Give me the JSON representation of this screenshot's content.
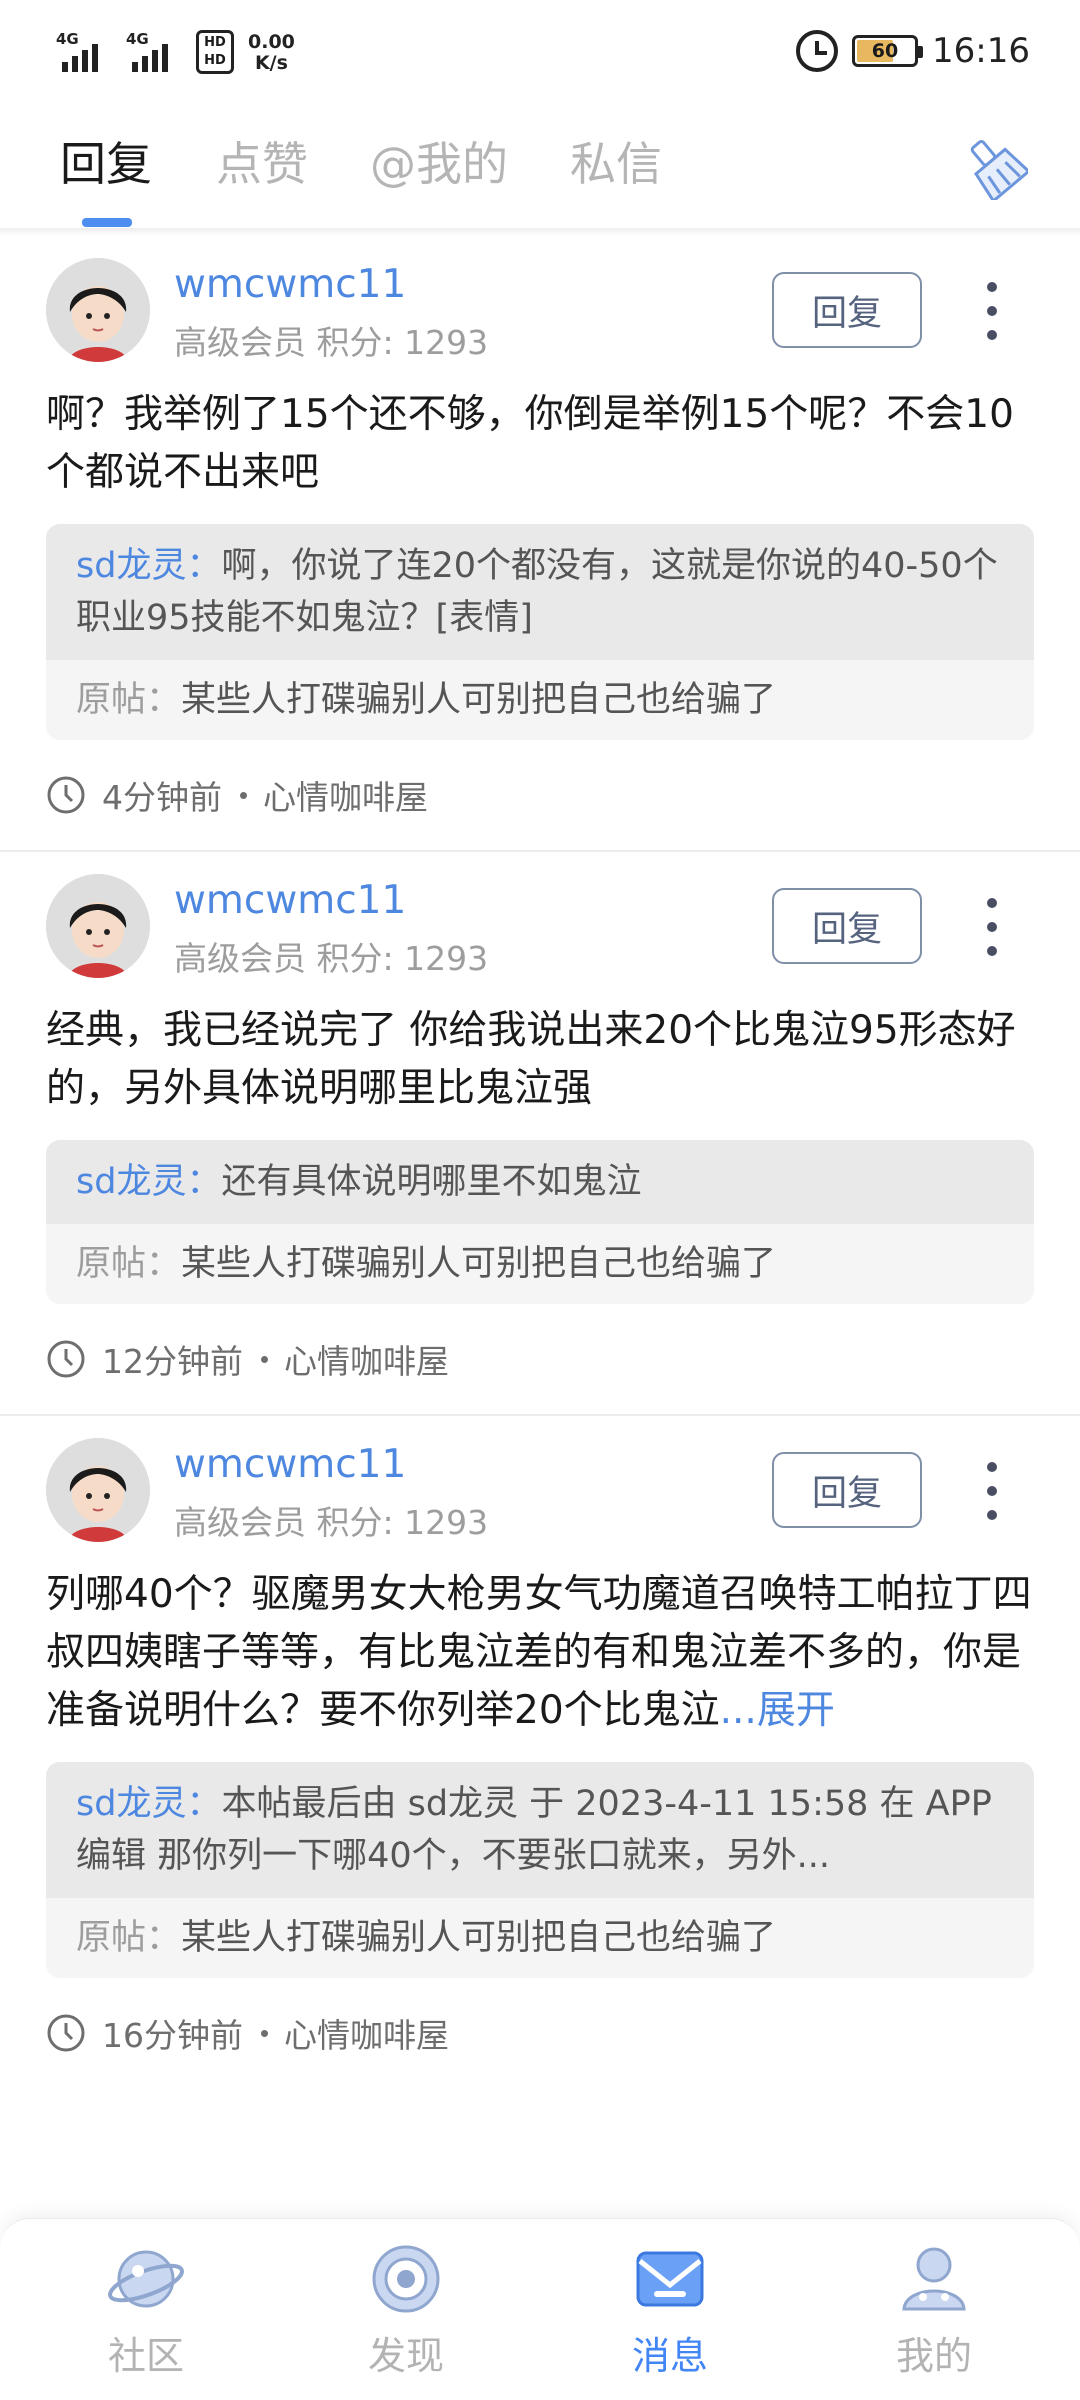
{
  "status_bar": {
    "sim1_label": "4G",
    "sim2_label": "4G",
    "hd_label_top": "HD",
    "hd_label_bottom": "HD",
    "speed_value": "0.00",
    "speed_unit": "K/s",
    "battery_level": "60",
    "time": "16:16",
    "icons": [
      "signal-icon",
      "signal-icon",
      "hd-icon",
      "alarm-icon",
      "battery-icon"
    ]
  },
  "tabs": [
    {
      "label": "回复",
      "active": true
    },
    {
      "label": "点赞",
      "active": false
    },
    {
      "label": "@我的",
      "active": false
    },
    {
      "label": "私信",
      "active": false
    }
  ],
  "header": {
    "clear_icon": "broom-icon"
  },
  "accent_color": "#4d8ef0",
  "messages": [
    {
      "username": "wmcwmc11",
      "level": "高级会员",
      "points_label": "积分: 1293",
      "reply_label": "回复",
      "content": "啊？我举例了15个还不够，你倒是举例15个呢？不会10个都说不出来吧",
      "quote_user": "sd龙灵：",
      "quote_text": "啊，你说了连20个都没有，这就是你说的40-50个职业95技能不如鬼泣？[表情]",
      "origin_label": "原帖：",
      "origin_text": "某些人打碟骗别人可别把自己也给骗了",
      "time": "4分钟前",
      "forum": "心情咖啡屋"
    },
    {
      "username": "wmcwmc11",
      "level": "高级会员",
      "points_label": "积分: 1293",
      "reply_label": "回复",
      "content": "经典，我已经说完了 你给我说出来20个比鬼泣95形态好的，另外具体说明哪里比鬼泣强",
      "quote_user": "sd龙灵：",
      "quote_text": "还有具体说明哪里不如鬼泣",
      "origin_label": "原帖：",
      "origin_text": "某些人打碟骗别人可别把自己也给骗了",
      "time": "12分钟前",
      "forum": "心情咖啡屋"
    },
    {
      "username": "wmcwmc11",
      "level": "高级会员",
      "points_label": "积分: 1293",
      "reply_label": "回复",
      "content": "列哪40个？驱魔男女大枪男女气功魔道召唤特工帕拉丁四叔四姨瞎子等等，有比鬼泣差的有和鬼泣差不多的，你是准备说明什么？要不你列举20个比鬼泣",
      "expand_label": "...展开",
      "quote_user": "sd龙灵：",
      "quote_text": "本帖最后由 sd龙灵 于 2023-4-11 15:58 在 APP 编辑 那你列一下哪40个，不要张口就来，另外...",
      "origin_label": "原帖：",
      "origin_text": "某些人打碟骗别人可别把自己也给骗了",
      "time": "16分钟前",
      "forum": "心情咖啡屋"
    }
  ],
  "bottom_nav": [
    {
      "label": "社区",
      "icon": "planet-icon",
      "active": false
    },
    {
      "label": "发现",
      "icon": "target-icon",
      "active": false
    },
    {
      "label": "消息",
      "icon": "mail-icon",
      "active": true
    },
    {
      "label": "我的",
      "icon": "user-icon",
      "active": false
    }
  ]
}
